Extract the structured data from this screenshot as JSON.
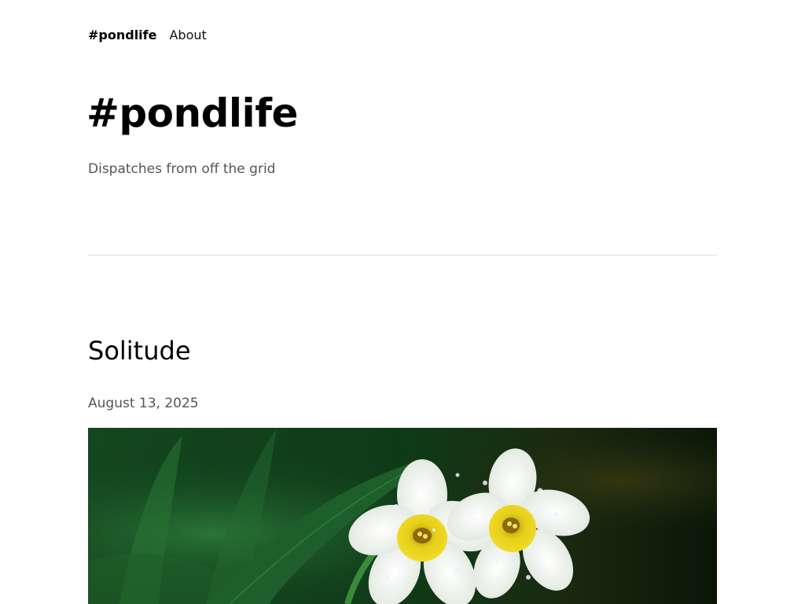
{
  "nav": {
    "brand": "#pondlife",
    "about": "About"
  },
  "hero": {
    "title": "#pondlife",
    "tagline": "Dispatches from off the grid"
  },
  "post": {
    "title": "Solitude",
    "date": "August 13, 2025",
    "image": "daffodil-photo"
  },
  "colors": {
    "text": "#000000",
    "muted": "#555555",
    "divider": "#dddddd",
    "petal": "#f4f6f0",
    "corona": "#e6cf1a",
    "foliage": "#1d5e2a"
  }
}
